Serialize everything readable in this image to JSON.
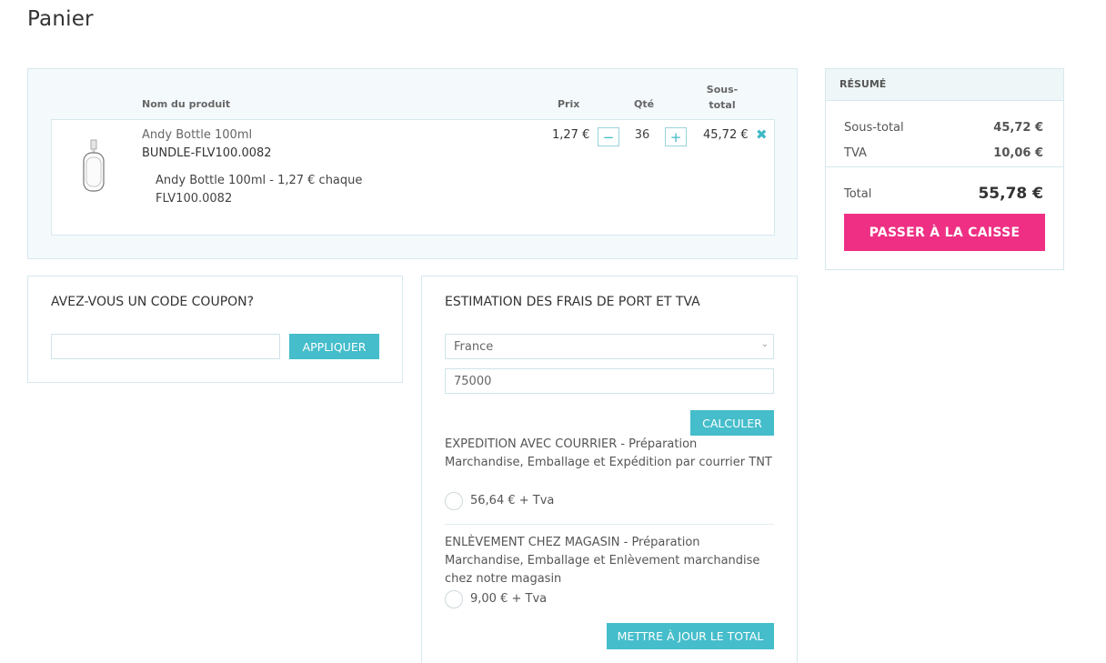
{
  "page": {
    "title": "Panier"
  },
  "cart": {
    "headers": {
      "name": "Nom du produit",
      "price": "Prix",
      "qty": "Qté",
      "subtotal_line1": "Sous-",
      "subtotal_line2": "total"
    },
    "item": {
      "name": "Andy Bottle 100ml",
      "sku": "BUNDLE-FLV100.0082",
      "bundle_line": "Andy Bottle 100ml - 1,27 € chaque",
      "bundle_sku": "FLV100.0082",
      "price": "1,27 €",
      "qty": "36",
      "subtotal": "45,72 €",
      "minus_symbol": "−",
      "plus_symbol": "+",
      "remove_symbol": "✖"
    }
  },
  "summary": {
    "title": "RÉSUMÉ",
    "subtotal_label": "Sous-total",
    "subtotal_value": "45,72 €",
    "tva_label": "TVA",
    "tva_value": "10,06 €",
    "total_label": "Total",
    "total_value": "55,78 €",
    "checkout_label": "PASSER À LA CAISSE"
  },
  "coupon": {
    "title": "AVEZ-VOUS UN CODE COUPON?",
    "input_value": "",
    "apply_label": "APPLIQUER"
  },
  "shipping": {
    "title": "ESTIMATION DES FRAIS DE PORT ET TVA",
    "country": "France",
    "zip": "75000",
    "calc_label": "CALCULER",
    "methods": [
      {
        "desc": "EXPEDITION AVEC COURRIER - Préparation Marchandise, Emballage et Expédition par courrier TNT",
        "rate": "56,64 € + Tva"
      },
      {
        "desc": "ENLÈVEMENT CHEZ MAGASIN - Préparation Marchandise, Emballage et Enlèvement marchandise chez notre magasin",
        "rate": "9,00 € + Tva"
      }
    ],
    "update_label": "METTRE À JOUR LE TOTAL"
  }
}
